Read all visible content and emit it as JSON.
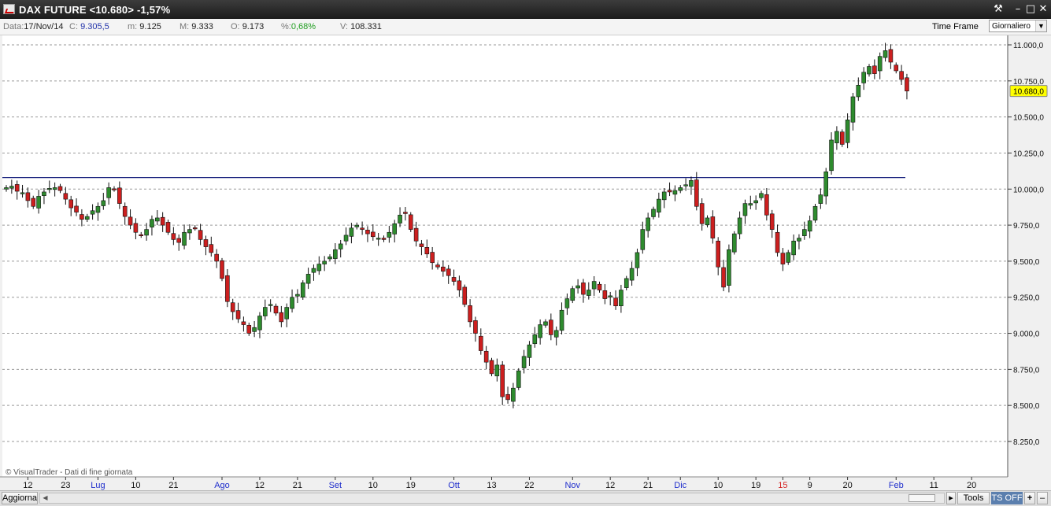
{
  "window": {
    "title": "DAX FUTURE <10.680> -1,57%"
  },
  "info": {
    "date_label": "Data:",
    "date": "17/Nov/14",
    "close_label": "C:",
    "close": "9.305,5",
    "min_label": "m:",
    "min": "9.125",
    "max_label": "M:",
    "max": "9.333",
    "open_label": "O:",
    "open": "9.173",
    "pct_label": "%:",
    "pct": "0,68%",
    "vol_label": "V:",
    "vol": "108.331",
    "timeframe_label": "Time Frame",
    "timeframe_value": "Giornaliero"
  },
  "copyright": "© VisualTrader - Dati di fine giornata",
  "bottom": {
    "aggiorna": "Aggiorna",
    "tools": "Tools",
    "ts": "TS OFF",
    "plus": "+",
    "arrow": "▸"
  },
  "colors": {
    "up": "#2e8b2e",
    "down": "#cc1f1f",
    "wick": "#111111",
    "hline": "#1a237e",
    "last_bg": "#ffff00",
    "grid": "#9a9a9a",
    "month": "#1f2ecc",
    "red_tick": "#d42020"
  },
  "chart_data": {
    "type": "candlestick",
    "ylim": [
      8100,
      11050
    ],
    "y_ticks": [
      8250,
      8500,
      8750,
      9000,
      9250,
      9500,
      9750,
      10000,
      10250,
      10500,
      10750,
      11000
    ],
    "y_tick_labels": [
      "8.250,0",
      "8.500,0",
      "8.750,0",
      "9.000,0",
      "9.250,0",
      "9.500,0",
      "9.750,0",
      "10.000,0",
      "10.250,0",
      "10.500,0",
      "10.750,0",
      "11.000,0"
    ],
    "last_price_label": "10.680,0",
    "last_price": 10680,
    "horizontal_line": 10080,
    "x_ticks": [
      {
        "label": "12",
        "index": 4
      },
      {
        "label": "23",
        "index": 11
      },
      {
        "label": "Lug",
        "index": 17,
        "style": "month"
      },
      {
        "label": "10",
        "index": 24
      },
      {
        "label": "21",
        "index": 31
      },
      {
        "label": "Ago",
        "index": 40,
        "style": "month"
      },
      {
        "label": "12",
        "index": 47
      },
      {
        "label": "21",
        "index": 54
      },
      {
        "label": "Set",
        "index": 61,
        "style": "month"
      },
      {
        "label": "10",
        "index": 68
      },
      {
        "label": "19",
        "index": 75
      },
      {
        "label": "Ott",
        "index": 83,
        "style": "month"
      },
      {
        "label": "13",
        "index": 90
      },
      {
        "label": "22",
        "index": 97
      },
      {
        "label": "Nov",
        "index": 105,
        "style": "month"
      },
      {
        "label": "12",
        "index": 112
      },
      {
        "label": "21",
        "index": 119
      },
      {
        "label": "Dic",
        "index": 125,
        "style": "month"
      },
      {
        "label": "10",
        "index": 132
      },
      {
        "label": "19",
        "index": 139
      },
      {
        "label": "15",
        "index": 144,
        "style": "red"
      },
      {
        "label": "9",
        "index": 149
      },
      {
        "label": "20",
        "index": 156
      },
      {
        "label": "Feb",
        "index": 165,
        "style": "month"
      },
      {
        "label": "11",
        "index": 172
      },
      {
        "label": "20",
        "index": 179
      }
    ],
    "closes": [
      10010,
      10020,
      9985,
      9975,
      9920,
      9880,
      9950,
      9980,
      10005,
      10010,
      9990,
      9930,
      9870,
      9840,
      9790,
      9810,
      9850,
      9880,
      9920,
      10010,
      10000,
      9900,
      9810,
      9750,
      9700,
      9680,
      9720,
      9790,
      9800,
      9750,
      9700,
      9650,
      9630,
      9700,
      9720,
      9730,
      9650,
      9600,
      9560,
      9500,
      9380,
      9220,
      9150,
      9100,
      9060,
      9000,
      9040,
      9120,
      9180,
      9200,
      9140,
      9080,
      9180,
      9250,
      9270,
      9350,
      9410,
      9450,
      9480,
      9500,
      9530,
      9580,
      9620,
      9680,
      9730,
      9750,
      9720,
      9690,
      9670,
      9660,
      9650,
      9700,
      9760,
      9820,
      9830,
      9720,
      9640,
      9600,
      9550,
      9490,
      9460,
      9430,
      9400,
      9360,
      9300,
      9200,
      9080,
      9000,
      8880,
      8800,
      8720,
      8780,
      8560,
      8540,
      8620,
      8740,
      8840,
      8920,
      8990,
      9060,
      9080,
      8990,
      9020,
      9160,
      9240,
      9310,
      9330,
      9270,
      9300,
      9360,
      9300,
      9240,
      9260,
      9190,
      9300,
      9380,
      9450,
      9560,
      9720,
      9800,
      9860,
      9930,
      9980,
      9980,
      9990,
      10010,
      10030,
      10060,
      9880,
      9760,
      9800,
      9660,
      9460,
      9320,
      9580,
      9690,
      9800,
      9900,
      9900,
      9920,
      9970,
      9820,
      9720,
      9560,
      9480,
      9560,
      9640,
      9660,
      9720,
      9780,
      9880,
      9960,
      10120,
      10340,
      10400,
      10310,
      10480,
      10640,
      10720,
      10810,
      10850,
      10800,
      10920,
      10960,
      10880,
      10820,
      10760,
      10680
    ]
  }
}
